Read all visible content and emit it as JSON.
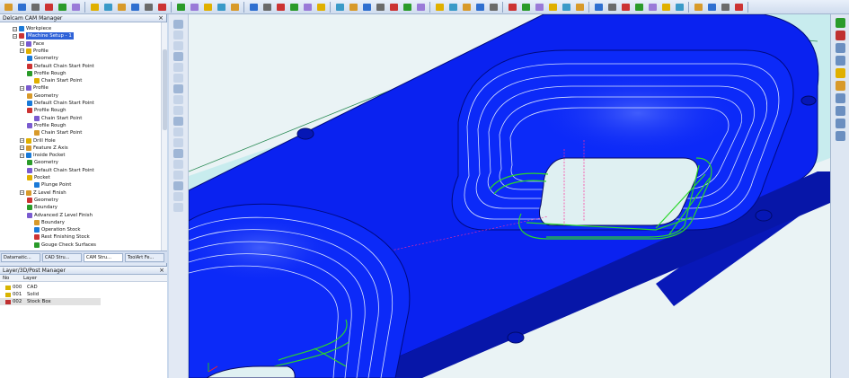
{
  "tree_panel": {
    "title": "Delcam CAM Manager",
    "items": [
      {
        "label": "Workpiece",
        "level": 1
      },
      {
        "label": "Machine Setup - 1",
        "level": 1,
        "selected": true
      },
      {
        "label": "Face",
        "level": 2
      },
      {
        "label": "Profile",
        "level": 2
      },
      {
        "label": "Geometry",
        "level": 3
      },
      {
        "label": "Default Chain Start Point",
        "level": 3
      },
      {
        "label": "Profile Rough",
        "level": 3
      },
      {
        "label": "Chain Start Point",
        "level": 4
      },
      {
        "label": "Profile",
        "level": 2
      },
      {
        "label": "Geometry",
        "level": 3
      },
      {
        "label": "Default Chain Start Point",
        "level": 3
      },
      {
        "label": "Profile Rough",
        "level": 3
      },
      {
        "label": "Chain Start Point",
        "level": 4
      },
      {
        "label": "Profile Rough",
        "level": 3
      },
      {
        "label": "Chain Start Point",
        "level": 4
      },
      {
        "label": "Drill Hole",
        "level": 2
      },
      {
        "label": "Feature Z Axis",
        "level": 2
      },
      {
        "label": "Inside Pocket",
        "level": 2
      },
      {
        "label": "Geometry",
        "level": 3
      },
      {
        "label": "Default Chain Start Point",
        "level": 3
      },
      {
        "label": "Pocket",
        "level": 3
      },
      {
        "label": "Plunge Point",
        "level": 4
      },
      {
        "label": "Z Level Finish",
        "level": 2
      },
      {
        "label": "Geometry",
        "level": 3
      },
      {
        "label": "Boundary",
        "level": 3
      },
      {
        "label": "Advanced Z Level Finish",
        "level": 3
      },
      {
        "label": "Boundary",
        "level": 4
      },
      {
        "label": "Operation Stock",
        "level": 4
      },
      {
        "label": "Rest Finishing Stock",
        "level": 4
      },
      {
        "label": "Gouge Check Surfaces",
        "level": 4
      }
    ]
  },
  "bottom_tabs": [
    {
      "label": "Datamatic..."
    },
    {
      "label": "CAD Stru..."
    },
    {
      "label": "CAM Stru..."
    },
    {
      "label": "ToolArt Fe..."
    }
  ],
  "layer_panel": {
    "title": "Layer/3D/Post Manager",
    "col_no": "No",
    "col_layer": "Layer",
    "rows": [
      {
        "no": "000",
        "name": "CAD"
      },
      {
        "no": "001",
        "name": "Solid"
      },
      {
        "no": "002",
        "name": "Stock Box"
      }
    ]
  },
  "colors": {
    "part_blue": "#0a22f0",
    "toolpath_green": "#2bd62b",
    "background": "#eaf3f5",
    "stock_cyan": "#c8ecee"
  }
}
